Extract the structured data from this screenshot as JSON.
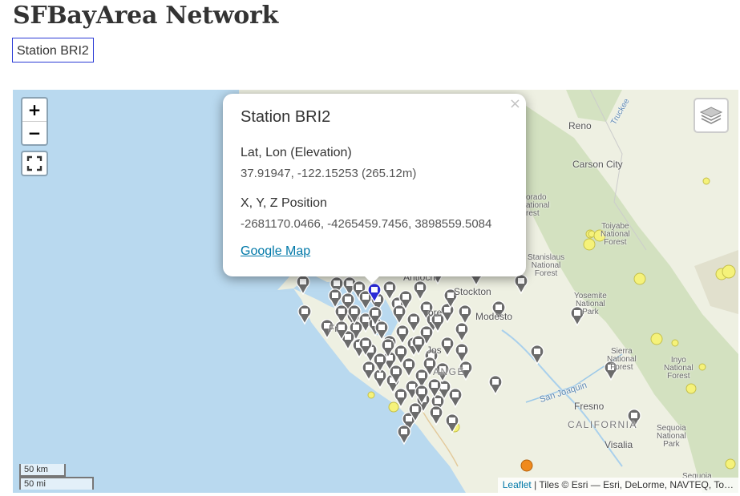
{
  "page": {
    "title": "SFBayArea Network",
    "station_button": "Station BRI2"
  },
  "map": {
    "controls": {
      "zoom_in": "+",
      "zoom_out": "−"
    },
    "scale": {
      "km": "50 km",
      "mi": "50 mi"
    },
    "attribution": {
      "link": "Leaflet",
      "text": " | Tiles © Esri — Esri, DeLorme, NAVTEQ, To…"
    },
    "labels": {
      "reno": "Reno",
      "carson_city": "Carson City",
      "stockton": "Stockton",
      "antioch": "Antioch",
      "modesto": "Modesto",
      "fresno": "Fresno",
      "visalia": "Visalia",
      "california": "CALIFORNIA",
      "san_joaquin": "San Joaquin",
      "truckee": "Truckee",
      "toiyabe": "Toiyabe\nNational\nForest",
      "stanislaus": "Stanislaus\nNational\nForest",
      "yosemite": "Yosemite\nNational\nPark",
      "sierra": "Sierra\nNational\nForest",
      "inyo": "Inyo\nNational\nForest",
      "sequoia_park": "Sequoia\nNational\nPark",
      "sequoia": "Sequoia",
      "eldorado": "orado\national\nrest",
      "fr": "Fr",
      "jos": "Jos",
      "ange": "ANGE",
      "vo": "ore"
    },
    "colors": {
      "water": "#b9d9ef",
      "land": "#eef0e2",
      "forest": "#c7d9b0",
      "marker": "#6b6b6b",
      "selected_marker": "#2a2ad6",
      "quake_yellow": "#f5f27a",
      "quake_orange": "#f08a1e"
    }
  },
  "popup": {
    "title": "Station BRI2",
    "latlon_label": "Lat, Lon (Elevation)",
    "latlon_value": "37.91947, -122.15253 (265.12m)",
    "xyz_label": "X, Y, Z Position",
    "xyz_value": "-2681170.0466, -4265459.7456, 3898559.5084",
    "link": "Google Map",
    "close": "×"
  }
}
